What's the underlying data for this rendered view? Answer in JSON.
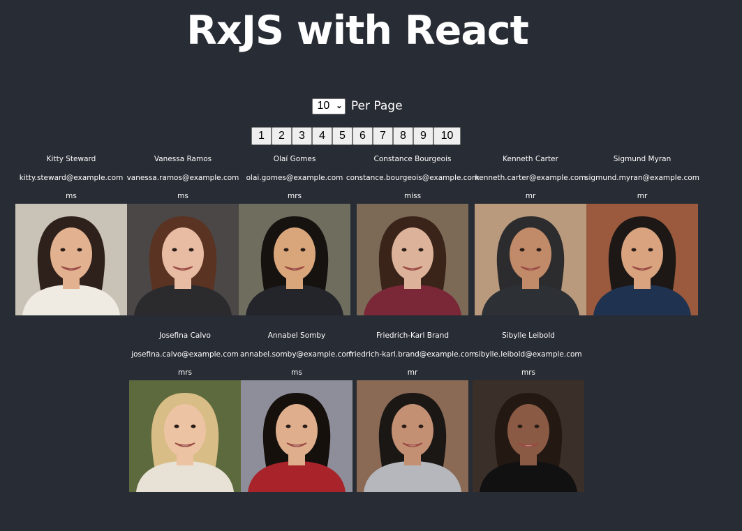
{
  "header": {
    "title": "RxJS with React"
  },
  "per_page": {
    "selected": "10",
    "label": "Per Page"
  },
  "pagination": {
    "pages": [
      "1",
      "2",
      "3",
      "4",
      "5",
      "6",
      "7",
      "8",
      "9",
      "10"
    ]
  },
  "users": [
    {
      "name": "Kitty Steward",
      "email": "kitty.steward@example.com",
      "title": "ms",
      "photo_icon": "user-photo-icon",
      "colors": {
        "bg": "#c9c2b6",
        "skin": "#e2b190",
        "hair": "#2e211b",
        "shirt": "#efeae2"
      }
    },
    {
      "name": "Vanessa Ramos",
      "email": "vanessa.ramos@example.com",
      "title": "ms",
      "photo_icon": "user-photo-icon",
      "colors": {
        "bg": "#4b4746",
        "skin": "#e8bba3",
        "hair": "#5a3322",
        "shirt": "#2b2b2e"
      }
    },
    {
      "name": "Olaí Gomes",
      "email": "olai.gomes@example.com",
      "title": "mrs",
      "photo_icon": "user-photo-icon",
      "colors": {
        "bg": "#6f6d5e",
        "skin": "#d9a57b",
        "hair": "#161210",
        "shirt": "#23252a"
      }
    },
    {
      "name": "Constance Bourgeois",
      "email": "constance.bourgeois@example.com",
      "title": "miss",
      "photo_icon": "user-photo-icon",
      "colors": {
        "bg": "#7c6a56",
        "skin": "#dcb39a",
        "hair": "#3a2419",
        "shirt": "#7a2738"
      }
    },
    {
      "name": "Kenneth Carter",
      "email": "kenneth.carter@example.com",
      "title": "mr",
      "photo_icon": "user-photo-icon",
      "colors": {
        "bg": "#b99a7d",
        "skin": "#c18a68",
        "hair": "#2c2c2e",
        "shirt": "#2d3035"
      }
    },
    {
      "name": "Sigmund Myran",
      "email": "sigmund.myran@example.com",
      "title": "mr",
      "photo_icon": "user-photo-icon",
      "colors": {
        "bg": "#9b5a3e",
        "skin": "#d9a37f",
        "hair": "#1d1815",
        "shirt": "#1f3350"
      }
    },
    {
      "name": "Josefina Calvo",
      "email": "josefina.calvo@example.com",
      "title": "mrs",
      "photo_icon": "user-photo-icon",
      "colors": {
        "bg": "#5d6a3d",
        "skin": "#ecc3a3",
        "hair": "#d8bd86",
        "shirt": "#e8e1d6"
      }
    },
    {
      "name": "Annabel Somby",
      "email": "annabel.somby@example.com",
      "title": "ms",
      "photo_icon": "user-photo-icon",
      "colors": {
        "bg": "#8e8e9a",
        "skin": "#deae8d",
        "hair": "#16100d",
        "shirt": "#a8242a"
      }
    },
    {
      "name": "Friedrich-Karl Brand",
      "email": "friedrich-karl.brand@example.com",
      "title": "mr",
      "photo_icon": "user-photo-icon",
      "colors": {
        "bg": "#8a6a55",
        "skin": "#c49073",
        "hair": "#1b1714",
        "shirt": "#b5b7bc"
      }
    },
    {
      "name": "Sibylle Leibold",
      "email": "sibylle.leibold@example.com",
      "title": "mrs",
      "photo_icon": "user-photo-icon",
      "colors": {
        "bg": "#3b2f2a",
        "skin": "#8a5a44",
        "hair": "#241813",
        "shirt": "#121112"
      }
    }
  ]
}
